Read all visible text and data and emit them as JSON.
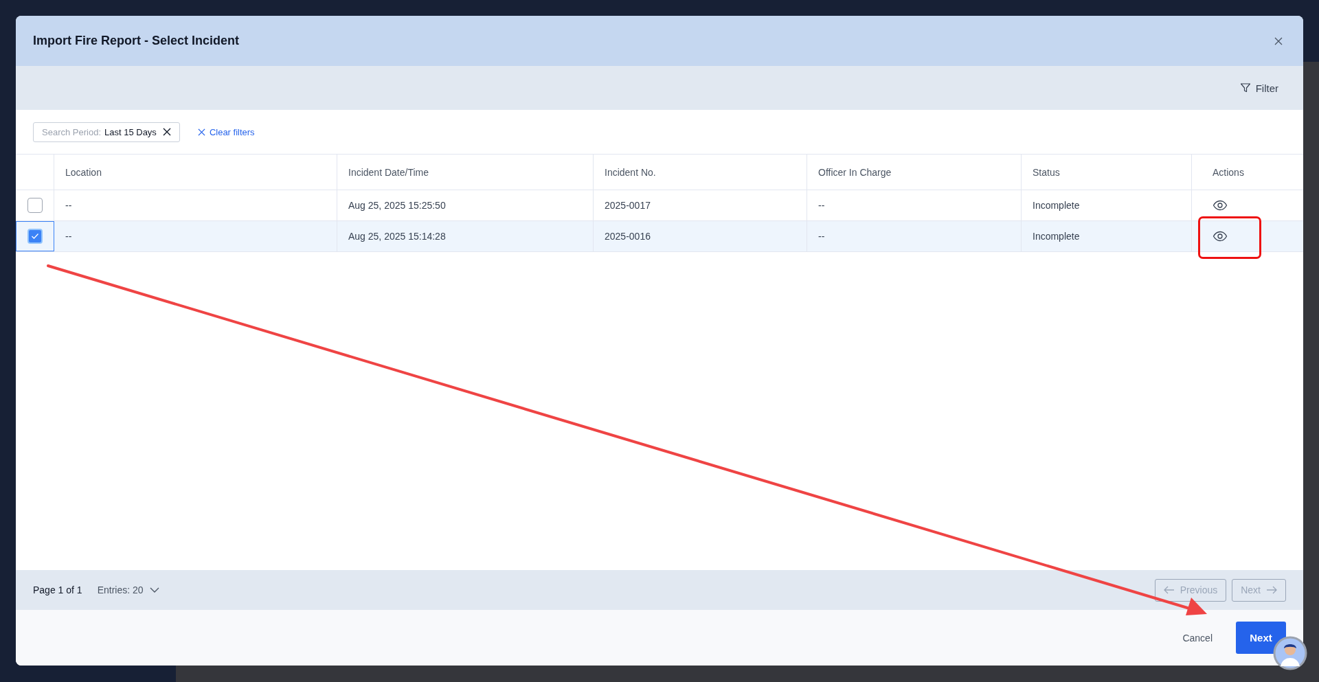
{
  "dialog": {
    "title": "Import Fire Report - Select Incident"
  },
  "toolbar": {
    "filter_button": "Filter"
  },
  "filters": {
    "chip": {
      "label": "Search Period:",
      "value": "Last 15 Days"
    },
    "clear": "Clear filters"
  },
  "table": {
    "columns": [
      "Location",
      "Incident Date/Time",
      "Incident No.",
      "Officer In Charge",
      "Status",
      "Actions"
    ],
    "rows": [
      {
        "selected": false,
        "highlighted": false,
        "cells": [
          "--",
          "Aug 25, 2025 15:25:50",
          "2025-0017",
          "--",
          "Incomplete"
        ]
      },
      {
        "selected": true,
        "highlighted": true,
        "cells": [
          "--",
          "Aug 25, 2025 15:14:28",
          "2025-0016",
          "--",
          "Incomplete"
        ]
      }
    ]
  },
  "pagination": {
    "page": "Page 1 of 1",
    "entries": "Entries: 20",
    "previous": {
      "label": "Previous",
      "disabled": true
    },
    "next": {
      "label": "Next",
      "disabled": true
    }
  },
  "footer": {
    "cancel": "Cancel",
    "next": "Next"
  }
}
